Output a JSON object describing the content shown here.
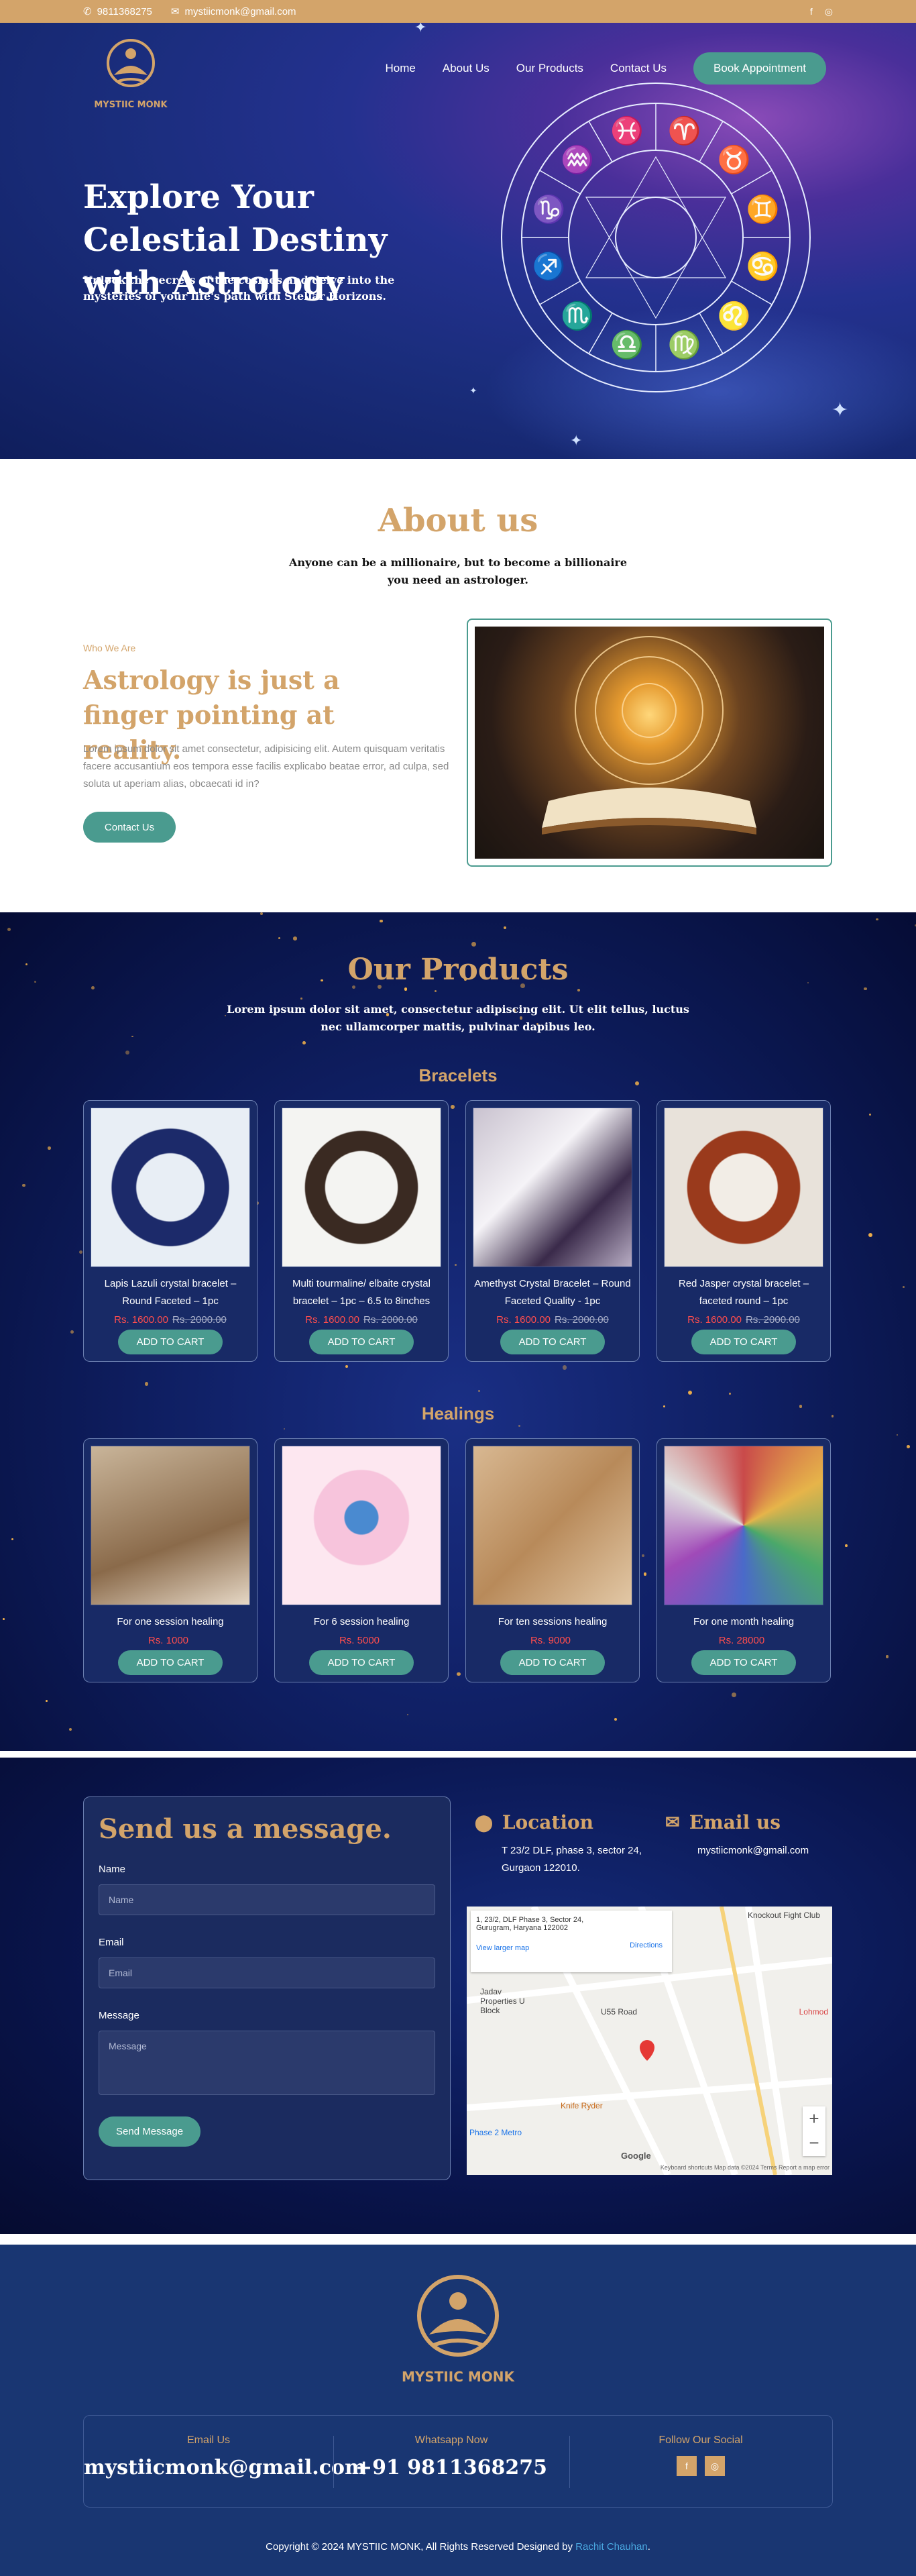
{
  "topbar": {
    "phone": "9811368275",
    "email": "mystiicmonk@gmail.com"
  },
  "brand": {
    "logo_text": "MYSTIIC MONK"
  },
  "nav": {
    "home": "Home",
    "about": "About Us",
    "products": "Our Products",
    "contact": "Contact Us",
    "cta": "Book Appointment"
  },
  "hero": {
    "title": "Explore Your Celestial Destiny with Astrology",
    "subtitle": "Unlock the secrets of the cosmos and delve into the mysteries of your life's path with Stellar Horizons."
  },
  "about": {
    "title": "About us",
    "subtitle": "Anyone can be a millionaire, but to become a billionaire you need an astrologer.",
    "eyebrow": "Who We Are",
    "heading": "Astrology is just a finger pointing at reality.",
    "body": "Lorem ipsum dolor sit amet consectetur, adipisicing elit. Autem quisquam veritatis facere accusantium eos tempora esse facilis explicabo beatae error, ad culpa, sed soluta ut aperiam alias, obcaecati id in?",
    "button": "Contact Us"
  },
  "products": {
    "title": "Our Products",
    "subtitle": "Lorem ipsum dolor sit amet, consectetur adipiscing elit. Ut elit tellus, luctus nec ullamcorper mattis, pulvinar dapibus leo.",
    "add_label": "ADD TO CART",
    "bracelets_title": "Bracelets",
    "bracelets": [
      {
        "name": "Lapis Lazuli crystal bracelet – Round Faceted – 1pc",
        "price": "Rs. 1600.00",
        "old_price": "Rs. 2000.00"
      },
      {
        "name": "Multi tourmaline/ elbaite crystal bracelet – 1pc – 6.5 to 8inches",
        "price": "Rs. 1600.00",
        "old_price": "Rs. 2000.00"
      },
      {
        "name": "Amethyst Crystal Bracelet – Round Faceted Quality - 1pc",
        "price": "Rs. 1600.00",
        "old_price": "Rs. 2000.00"
      },
      {
        "name": "Red Jasper crystal bracelet – faceted round – 1pc",
        "price": "Rs. 1600.00",
        "old_price": "Rs. 2000.00"
      }
    ],
    "healings_title": "Healings",
    "healings": [
      {
        "name": "For one session healing",
        "price": "Rs. 1000"
      },
      {
        "name": "For 6 session healing",
        "price": "Rs. 5000"
      },
      {
        "name": "For ten sessions healing",
        "price": "Rs. 9000"
      },
      {
        "name": "For one month healing",
        "price": "Rs. 28000"
      }
    ]
  },
  "contact": {
    "title": "Send us a message.",
    "name_label": "Name",
    "name_placeholder": "Name",
    "email_label": "Email",
    "email_placeholder": "Email",
    "message_label": "Message",
    "message_placeholder": "Message",
    "send": "Send Message",
    "location_title": "Location",
    "location_text": "T 23/2 DLF, phase 3, sector 24, Gurgaon 122010.",
    "email_title": "Email us",
    "email_text": "mystiicmonk@gmail.com",
    "map": {
      "card_text": "1, 23/2, DLF Phase 3, Sector 24, Gurugram, Haryana 122002",
      "directions": "Directions",
      "larger": "View larger map",
      "labels": [
        "Knockout Fight Club",
        "Jadav Properties U Block",
        "U55 Road",
        "Knife Ryder",
        "Phase 2 Metro",
        "Lohmod"
      ],
      "footer": "Keyboard shortcuts   Map data ©2024   Terms   Report a map error",
      "google": "Google"
    }
  },
  "footer": {
    "email_label": "Email Us",
    "email_value": "mystiicmonk@gmail.com",
    "whatsapp_label": "Whatsapp Now",
    "whatsapp_value": "+91 9811368275",
    "social_label": "Follow Our Social",
    "copyright": "Copyright © 2024 MYSTIIC MONK, All Rights Reserved Designed by",
    "designer": "Rachit Chauhan"
  },
  "colors": {
    "gold": "#d3a46a",
    "teal": "#4a9b8f",
    "navy": "#193672",
    "sale": "#ff4d4d"
  }
}
